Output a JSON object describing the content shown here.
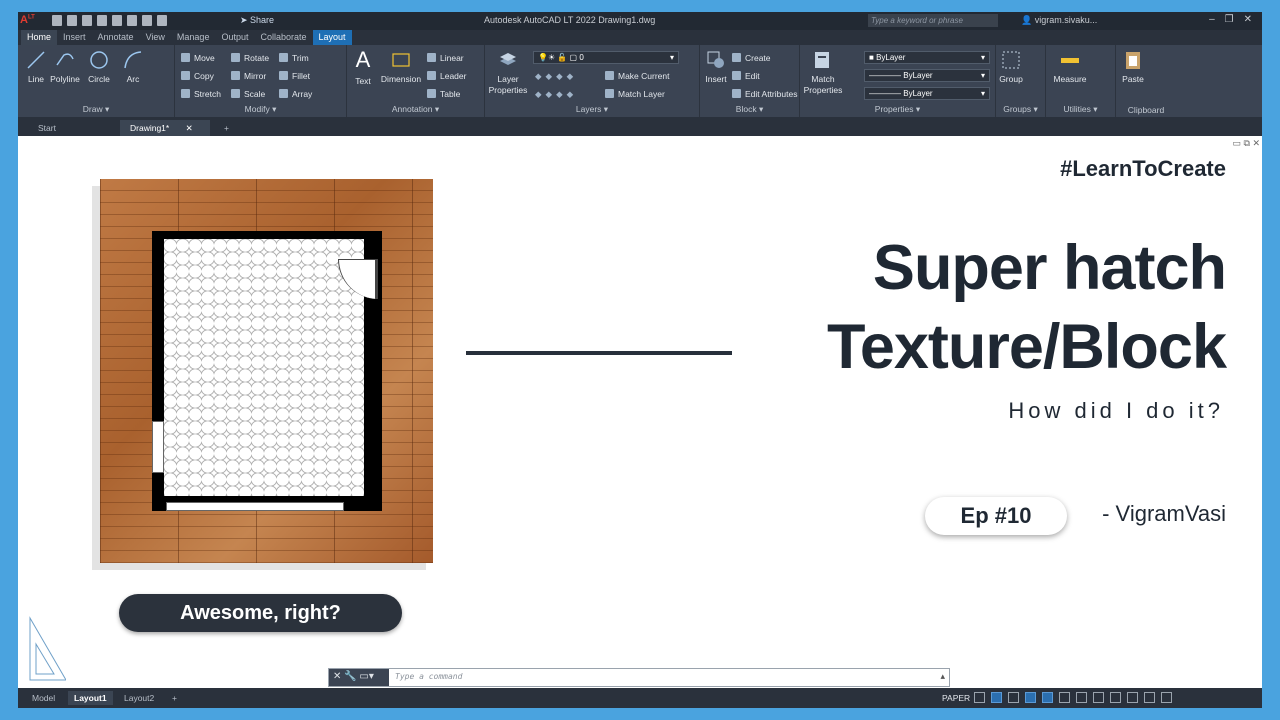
{
  "titlebar": {
    "logo": "A",
    "logo_sup": "LT",
    "share_label": "Share",
    "app_title": "Autodesk AutoCAD LT 2022   Drawing1.dwg",
    "search_placeholder": "Type a keyword or phrase",
    "user": "vigram.sivaku..."
  },
  "tabs": [
    "Home",
    "Insert",
    "Annotate",
    "View",
    "Manage",
    "Output",
    "Collaborate",
    "Layout"
  ],
  "ribbon": {
    "draw": {
      "title": "Draw",
      "tools": [
        "Line",
        "Polyline",
        "Circle",
        "Arc"
      ]
    },
    "modify": {
      "title": "Modify",
      "items": [
        "Move",
        "Rotate",
        "Trim",
        "Copy",
        "Mirror",
        "Fillet",
        "Stretch",
        "Scale",
        "Array"
      ]
    },
    "annotation": {
      "title": "Annotation",
      "text": "Text",
      "dimension": "Dimension",
      "linear": "Linear",
      "leader": "Leader",
      "table": "Table"
    },
    "layers": {
      "title": "Layers",
      "layer_properties": "Layer Properties",
      "current_layer": "0",
      "make_current": "Make Current",
      "match_layer": "Match Layer"
    },
    "block": {
      "title": "Block",
      "insert": "Insert",
      "create": "Create",
      "edit": "Edit",
      "edit_attributes": "Edit Attributes"
    },
    "properties": {
      "title": "Properties",
      "match_properties": "Match Properties",
      "color": "ByLayer",
      "linetype": "ByLayer",
      "lineweight": "ByLayer"
    },
    "groups": {
      "title": "Groups",
      "group": "Group"
    },
    "utilities": {
      "title": "Utilities",
      "measure": "Measure"
    },
    "clipboard": {
      "title": "Clipboard",
      "paste": "Paste"
    }
  },
  "filetabs": {
    "start": "Start",
    "drawing": "Drawing1*"
  },
  "content": {
    "hashtag": "#LearnToCreate",
    "title_line1": "Super hatch",
    "title_line2": "Texture/Block",
    "subtitle": "How did I do it?",
    "episode": "Ep #10",
    "author": "- VigramVasi",
    "callout": "Awesome, right?"
  },
  "command": {
    "placeholder": "Type a command"
  },
  "status": {
    "tabs": [
      "Model",
      "Layout1",
      "Layout2"
    ],
    "space": "PAPER"
  },
  "colors": {
    "accent": "#1e6fb5",
    "frame": "#4aa3df",
    "text_dark": "#1f2833",
    "wood": "#b06a37"
  }
}
